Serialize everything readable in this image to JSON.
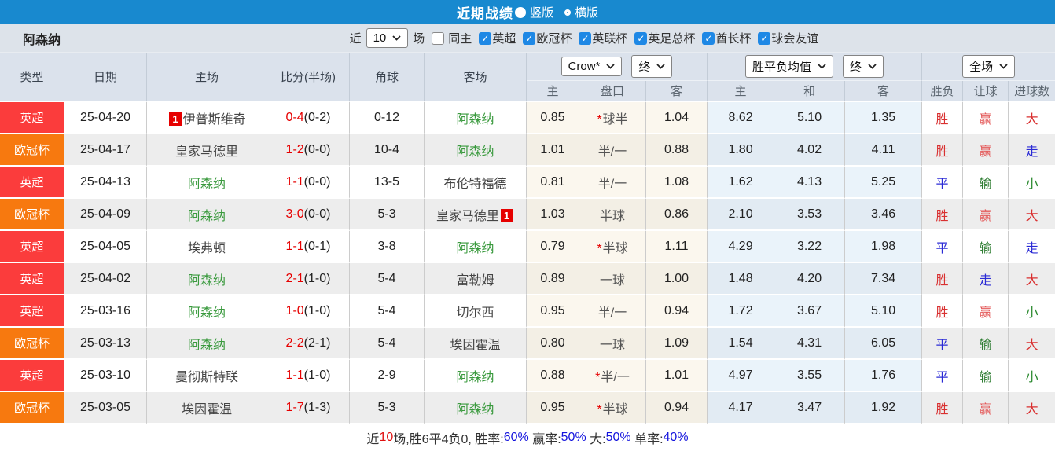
{
  "topbar": {
    "title": "近期战绩",
    "layout_options": [
      {
        "label": "竖版",
        "selected": true
      },
      {
        "label": "横版",
        "selected": false
      }
    ]
  },
  "filterbar": {
    "team": "阿森纳",
    "recent_prefix": "近",
    "recent_count": "10",
    "recent_suffix": "场",
    "checkboxes": [
      {
        "label": "同主",
        "checked": false
      },
      {
        "label": "英超",
        "checked": true
      },
      {
        "label": "欧冠杯",
        "checked": true
      },
      {
        "label": "英联杯",
        "checked": true
      },
      {
        "label": "英足总杯",
        "checked": true
      },
      {
        "label": "酋长杯",
        "checked": true
      },
      {
        "label": "球会友谊",
        "checked": true
      }
    ]
  },
  "table": {
    "left_headers": [
      "类型",
      "日期",
      "主场",
      "比分(半场)",
      "角球",
      "客场"
    ],
    "dropdowns": {
      "handicap_source": "Crow*",
      "handicap_time": "终",
      "odds_source": "胜平负均值",
      "odds_time": "终",
      "period": "全场"
    },
    "sub_headers": [
      "主",
      "盘口",
      "客",
      "主",
      "和",
      "客",
      "胜负",
      "让球",
      "进球数"
    ],
    "rows": [
      {
        "league": "英超",
        "date": "25-04-20",
        "home": {
          "name": "伊普斯维奇",
          "highlight": false,
          "red_card": "before",
          "red_card_count": "1"
        },
        "score": "0-4",
        "half": "(0-2)",
        "corners": "0-12",
        "away": {
          "name": "阿森纳",
          "highlight": true
        },
        "ah_home": "0.85",
        "ah_star": true,
        "ah_line": "球半",
        "ah_away": "1.04",
        "odds_home": "8.62",
        "odds_draw": "5.10",
        "odds_away": "1.35",
        "wdl": "胜",
        "ah_result": "赢",
        "ou_result": "大"
      },
      {
        "league": "欧冠杯",
        "date": "25-04-17",
        "home": {
          "name": "皇家马德里",
          "highlight": false
        },
        "score": "1-2",
        "half": "(0-0)",
        "corners": "10-4",
        "away": {
          "name": "阿森纳",
          "highlight": true
        },
        "ah_home": "1.01",
        "ah_star": false,
        "ah_line": "半/一",
        "ah_away": "0.88",
        "odds_home": "1.80",
        "odds_draw": "4.02",
        "odds_away": "4.11",
        "wdl": "胜",
        "ah_result": "赢",
        "ou_result": "走"
      },
      {
        "league": "英超",
        "date": "25-04-13",
        "home": {
          "name": "阿森纳",
          "highlight": true
        },
        "score": "1-1",
        "half": "(0-0)",
        "corners": "13-5",
        "away": {
          "name": "布伦特福德",
          "highlight": false
        },
        "ah_home": "0.81",
        "ah_star": false,
        "ah_line": "半/一",
        "ah_away": "1.08",
        "odds_home": "1.62",
        "odds_draw": "4.13",
        "odds_away": "5.25",
        "wdl": "平",
        "ah_result": "输",
        "ou_result": "小"
      },
      {
        "league": "欧冠杯",
        "date": "25-04-09",
        "home": {
          "name": "阿森纳",
          "highlight": true
        },
        "score": "3-0",
        "half": "(0-0)",
        "corners": "5-3",
        "away": {
          "name": "皇家马德里",
          "highlight": false,
          "red_card": "after",
          "red_card_count": "1"
        },
        "ah_home": "1.03",
        "ah_star": false,
        "ah_line": "半球",
        "ah_away": "0.86",
        "odds_home": "2.10",
        "odds_draw": "3.53",
        "odds_away": "3.46",
        "wdl": "胜",
        "ah_result": "赢",
        "ou_result": "大"
      },
      {
        "league": "英超",
        "date": "25-04-05",
        "home": {
          "name": "埃弗顿",
          "highlight": false
        },
        "score": "1-1",
        "half": "(0-1)",
        "corners": "3-8",
        "away": {
          "name": "阿森纳",
          "highlight": true
        },
        "ah_home": "0.79",
        "ah_star": true,
        "ah_line": "半球",
        "ah_away": "1.11",
        "odds_home": "4.29",
        "odds_draw": "3.22",
        "odds_away": "1.98",
        "wdl": "平",
        "ah_result": "输",
        "ou_result": "走"
      },
      {
        "league": "英超",
        "date": "25-04-02",
        "home": {
          "name": "阿森纳",
          "highlight": true
        },
        "score": "2-1",
        "half": "(1-0)",
        "corners": "5-4",
        "away": {
          "name": "富勒姆",
          "highlight": false
        },
        "ah_home": "0.89",
        "ah_star": false,
        "ah_line": "一球",
        "ah_away": "1.00",
        "odds_home": "1.48",
        "odds_draw": "4.20",
        "odds_away": "7.34",
        "wdl": "胜",
        "ah_result": "走",
        "ou_result": "大"
      },
      {
        "league": "英超",
        "date": "25-03-16",
        "home": {
          "name": "阿森纳",
          "highlight": true
        },
        "score": "1-0",
        "half": "(1-0)",
        "corners": "5-4",
        "away": {
          "name": "切尔西",
          "highlight": false
        },
        "ah_home": "0.95",
        "ah_star": false,
        "ah_line": "半/一",
        "ah_away": "0.94",
        "odds_home": "1.72",
        "odds_draw": "3.67",
        "odds_away": "5.10",
        "wdl": "胜",
        "ah_result": "赢",
        "ou_result": "小"
      },
      {
        "league": "欧冠杯",
        "date": "25-03-13",
        "home": {
          "name": "阿森纳",
          "highlight": true
        },
        "score": "2-2",
        "half": "(2-1)",
        "corners": "5-4",
        "away": {
          "name": "埃因霍温",
          "highlight": false
        },
        "ah_home": "0.80",
        "ah_star": false,
        "ah_line": "一球",
        "ah_away": "1.09",
        "odds_home": "1.54",
        "odds_draw": "4.31",
        "odds_away": "6.05",
        "wdl": "平",
        "ah_result": "输",
        "ou_result": "大"
      },
      {
        "league": "英超",
        "date": "25-03-10",
        "home": {
          "name": "曼彻斯特联",
          "highlight": false
        },
        "score": "1-1",
        "half": "(1-0)",
        "corners": "2-9",
        "away": {
          "name": "阿森纳",
          "highlight": true
        },
        "ah_home": "0.88",
        "ah_star": true,
        "ah_line": "半/一",
        "ah_away": "1.01",
        "odds_home": "4.97",
        "odds_draw": "3.55",
        "odds_away": "1.76",
        "wdl": "平",
        "ah_result": "输",
        "ou_result": "小"
      },
      {
        "league": "欧冠杯",
        "date": "25-03-05",
        "home": {
          "name": "埃因霍温",
          "highlight": false
        },
        "score": "1-7",
        "half": "(1-3)",
        "corners": "5-3",
        "away": {
          "name": "阿森纳",
          "highlight": true
        },
        "ah_home": "0.95",
        "ah_star": true,
        "ah_line": "半球",
        "ah_away": "0.94",
        "odds_home": "4.17",
        "odds_draw": "3.47",
        "odds_away": "1.92",
        "wdl": "胜",
        "ah_result": "赢",
        "ou_result": "大"
      }
    ]
  },
  "summary": {
    "segments": [
      {
        "text": "近",
        "color": "dark"
      },
      {
        "text": "10",
        "color": "red"
      },
      {
        "text": "场,胜6平4负0, 胜率:",
        "color": "dark"
      },
      {
        "text": "60%",
        "color": "blue"
      },
      {
        "text": " 赢率:",
        "color": "dark"
      },
      {
        "text": "50%",
        "color": "blue"
      },
      {
        "text": " 大:",
        "color": "dark"
      },
      {
        "text": "50%",
        "color": "blue"
      },
      {
        "text": " 单率:",
        "color": "dark"
      },
      {
        "text": "40%",
        "color": "blue"
      }
    ]
  },
  "colors": {
    "topbar_bg": "#1889cf",
    "checkbox_blue": "#1e88e5",
    "league": {
      "英超": "#fb3c3c",
      "欧冠杯": "#f7790f"
    },
    "team_highlight": "#3a9a3e",
    "score": "#e60000",
    "red_card_badge": "#e60000",
    "handicap_star": "#e60000",
    "result": {
      "胜": "#d93030",
      "平": "#2b2bd5",
      "赢": "#e45b5b",
      "输": "#2e7d32",
      "走": "#2b2bd5",
      "大": "#d93030",
      "小": "#2e8b32"
    }
  }
}
